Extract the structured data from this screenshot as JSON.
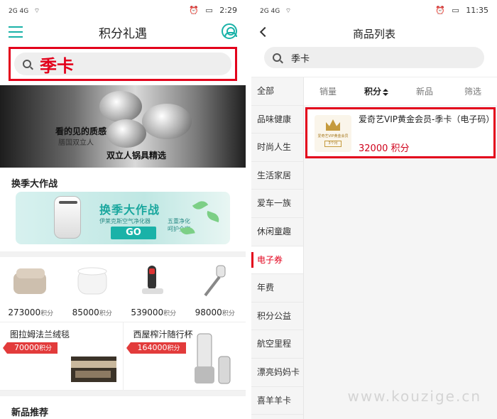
{
  "left": {
    "status": {
      "signal": "2G 4G",
      "time": "2:29"
    },
    "header": {
      "title": "积分礼遇"
    },
    "search": {
      "query": "季卡"
    },
    "banner": {
      "line1": "看的见的质感",
      "line2": "膳国双立人",
      "line3": "双立人锅具精选"
    },
    "season": {
      "section_title": "换季大作战",
      "banner_title": "换季大作战",
      "banner_sub": "伊莱克斯空气净化器",
      "go": "GO",
      "tag_line1": "五重净化",
      "tag_line2": "呵护全家"
    },
    "products": [
      {
        "icon": "blanket",
        "price": "273000",
        "unit": "积分"
      },
      {
        "icon": "humidifier",
        "price": "85000",
        "unit": "积分"
      },
      {
        "icon": "handheld-vacuum",
        "price": "539000",
        "unit": "积分"
      },
      {
        "icon": "stick-vacuum",
        "price": "98000",
        "unit": "积分"
      }
    ],
    "deals": [
      {
        "name": "图拉姆法兰绒毯",
        "price": "70000",
        "unit": "积分"
      },
      {
        "name": "西屋榨汁随行杯",
        "price": "164000",
        "unit": "积分"
      }
    ],
    "new_title": "新品推荐"
  },
  "right": {
    "status": {
      "signal": "2G 4G",
      "time": "11:35"
    },
    "header": {
      "title": "商品列表"
    },
    "search": {
      "query": "季卡"
    },
    "categories": [
      "全部",
      "品味健康",
      "时尚人生",
      "生活家居",
      "爱车一族",
      "休闲童趣",
      "电子券",
      "年费",
      "积分公益",
      "航空里程",
      "漂亮妈妈卡",
      "喜羊羊卡"
    ],
    "active_category": "电子券",
    "sorts": [
      "销量",
      "积分",
      "新品",
      "筛选"
    ],
    "active_sort": "积分",
    "item": {
      "name": "爱奇艺VIP黄金会员-季卡（电子码）",
      "points": "32000 积分",
      "thumb_text": "爱奇艺VIP黄金会员",
      "thumb_badge": "3个月"
    }
  },
  "watermark": "www.kouzige.cn",
  "colors": {
    "accent_red": "#e3001b",
    "teal": "#1ab2a8"
  }
}
